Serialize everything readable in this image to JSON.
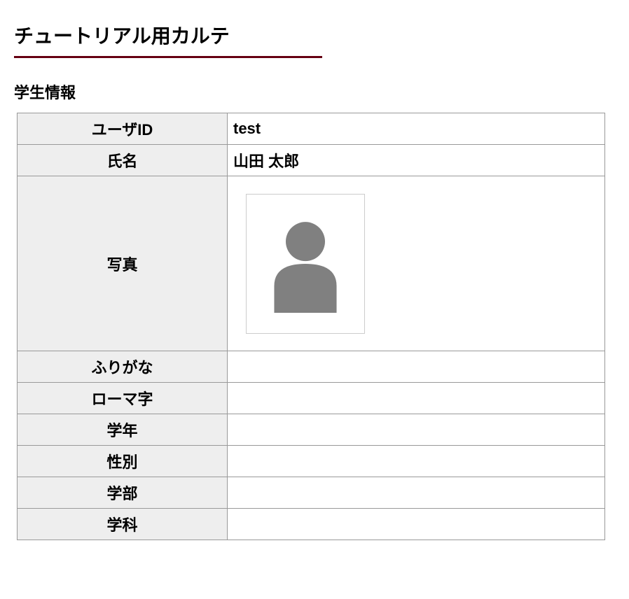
{
  "page": {
    "title": "チュートリアル用カルテ"
  },
  "section": {
    "title": "学生情報"
  },
  "student": {
    "user_id_label": "ユーザID",
    "user_id_value": "test",
    "name_label": "氏名",
    "name_value": "山田 太郎",
    "photo_label": "写真",
    "furigana_label": "ふりがな",
    "furigana_value": "",
    "romaji_label": "ローマ字",
    "romaji_value": "",
    "grade_label": "学年",
    "grade_value": "",
    "gender_label": "性別",
    "gender_value": "",
    "faculty_label": "学部",
    "faculty_value": "",
    "department_label": "学科",
    "department_value": ""
  }
}
